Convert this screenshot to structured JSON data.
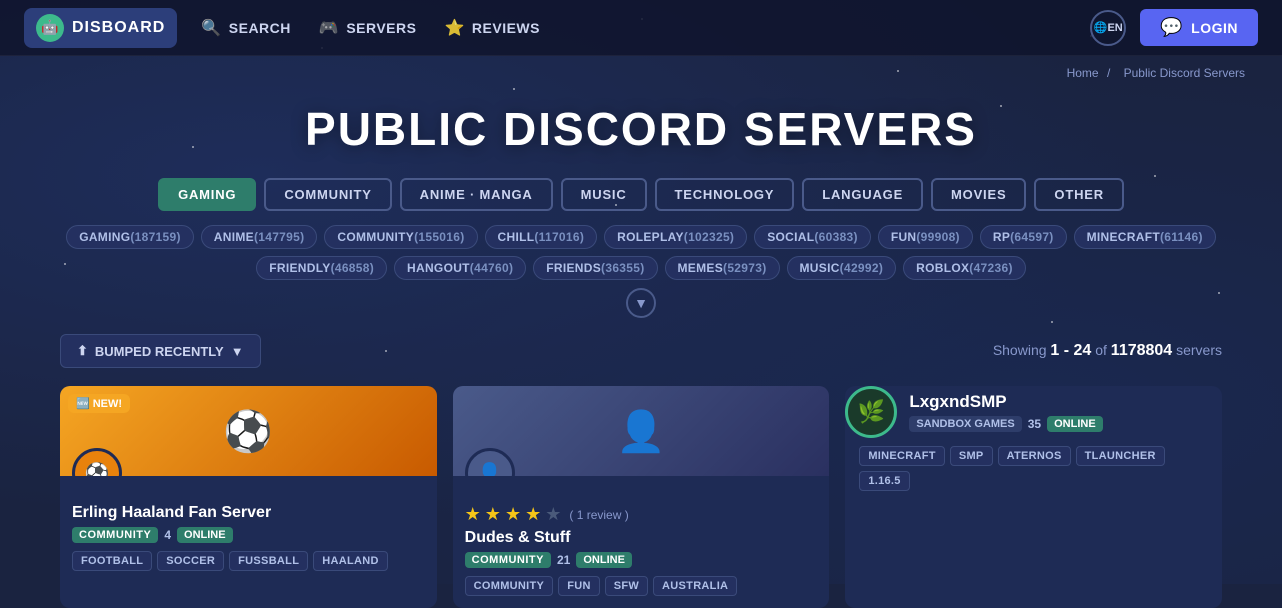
{
  "site": {
    "logo_text": "DISBOARD",
    "logo_icon": "🤖"
  },
  "nav": {
    "search_label": "SEARCH",
    "servers_label": "SERVERS",
    "reviews_label": "REVIEWS"
  },
  "header": {
    "lang_label": "EN",
    "login_label": "LOGIN"
  },
  "breadcrumb": {
    "home": "Home",
    "separator": "/",
    "current": "Public Discord Servers"
  },
  "page_title": "PUBLIC DISCORD SERVERS",
  "categories": [
    {
      "id": "gaming",
      "label": "GAMING",
      "active": true
    },
    {
      "id": "community",
      "label": "COMMUNITY",
      "active": false
    },
    {
      "id": "anime-manga",
      "label": "ANIME · MANGA",
      "active": false
    },
    {
      "id": "music",
      "label": "MUSIC",
      "active": false
    },
    {
      "id": "technology",
      "label": "TECHNOLOGY",
      "active": false
    },
    {
      "id": "language",
      "label": "LANGUAGE",
      "active": false
    },
    {
      "id": "movies",
      "label": "MOVIES",
      "active": false
    },
    {
      "id": "other",
      "label": "OTHER",
      "active": false
    }
  ],
  "tags": [
    {
      "label": "GAMING",
      "count": "187159"
    },
    {
      "label": "ANIME",
      "count": "147795"
    },
    {
      "label": "COMMUNITY",
      "count": "155016"
    },
    {
      "label": "CHILL",
      "count": "117016"
    },
    {
      "label": "ROLEPLAY",
      "count": "102325"
    },
    {
      "label": "SOCIAL",
      "count": "60383"
    },
    {
      "label": "FUN",
      "count": "99908"
    },
    {
      "label": "RP",
      "count": "64597"
    },
    {
      "label": "MINECRAFT",
      "count": "61146"
    },
    {
      "label": "FRIENDLY",
      "count": "46858"
    },
    {
      "label": "HANGOUT",
      "count": "44760"
    },
    {
      "label": "FRIENDS",
      "count": "36355"
    },
    {
      "label": "MEMES",
      "count": "52973"
    },
    {
      "label": "MUSIC",
      "count": "42992"
    },
    {
      "label": "ROBLOX",
      "count": "47236"
    }
  ],
  "filter": {
    "bumped_label": "BUMPED RECENTLY",
    "showing_label": "Showing",
    "range": "1 - 24",
    "of_label": "of",
    "total": "1178804",
    "servers_label": "servers"
  },
  "servers": [
    {
      "id": "haaland",
      "name": "Erling Haaland Fan Server",
      "is_new": true,
      "new_label": "NEW!",
      "category": "COMMUNITY",
      "member_count": "4",
      "online_label": "ONLINE",
      "tags": [
        "FOOTBALL",
        "SOCCER",
        "FUSSBALL",
        "HAALAND"
      ],
      "banner_type": "haaland",
      "avatar_emoji": "⚽",
      "has_rating": false,
      "rating": null,
      "review_count": null
    },
    {
      "id": "dudes-stuff",
      "name": "Dudes & Stuff",
      "is_new": false,
      "new_label": null,
      "category": "COMMUNITY",
      "member_count": "21",
      "online_label": "ONLINE",
      "tags": [
        "COMMUNITY",
        "FUN",
        "SFW",
        "AUSTRALIA"
      ],
      "banner_type": "dudes",
      "avatar_emoji": "👤",
      "has_rating": true,
      "rating": 4,
      "max_rating": 5,
      "review_count": "1 review"
    },
    {
      "id": "lxgxndsmp",
      "name": "LxgxndSMP",
      "is_new": false,
      "new_label": null,
      "category": "SANDBOX GAMES",
      "member_count": "35",
      "online_label": "ONLINE",
      "tags": [
        "MINECRAFT",
        "SMP",
        "ATERNOS",
        "TLAUNCHER",
        "1.16.5"
      ],
      "banner_type": "lxg",
      "avatar_emoji": "🌿",
      "has_rating": false,
      "rating": null,
      "review_count": null
    }
  ]
}
